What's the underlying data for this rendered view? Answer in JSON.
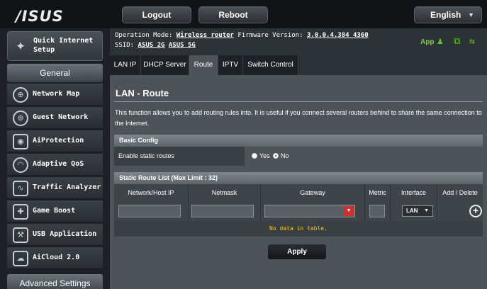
{
  "header": {
    "logo": "/ISUS",
    "logout_label": "Logout",
    "reboot_label": "Reboot",
    "language": "English"
  },
  "sidebar": {
    "quick_setup_label": "Quick Internet Setup",
    "general_label": "General",
    "items": [
      {
        "label": "Network Map",
        "icon": "network-map-icon"
      },
      {
        "label": "Guest Network",
        "icon": "guest-network-icon"
      },
      {
        "label": "AiProtection",
        "icon": "aiprotection-icon"
      },
      {
        "label": "Adaptive QoS",
        "icon": "adaptive-qos-icon"
      },
      {
        "label": "Traffic Analyzer",
        "icon": "traffic-analyzer-icon"
      },
      {
        "label": "Game Boost",
        "icon": "game-boost-icon"
      },
      {
        "label": "USB Application",
        "icon": "usb-application-icon"
      },
      {
        "label": "AiCloud 2.0",
        "icon": "aicloud-icon"
      }
    ],
    "advanced_label": "Advanced Settings"
  },
  "status": {
    "op_mode_label": "Operation Mode:",
    "op_mode_value": "Wireless router",
    "firmware_label": "Firmware Version:",
    "firmware_value": "3.0.0.4.384_4360",
    "ssid_label": "SSID:",
    "ssid_2g": "ASUS_2G",
    "ssid_5g": "ASUS_5G",
    "app_label": "App"
  },
  "tabs": [
    "LAN IP",
    "DHCP Server",
    "Route",
    "IPTV",
    "Switch Control"
  ],
  "active_tab": "Route",
  "page": {
    "title": "LAN - Route",
    "description": "This function allows you to add routing rules into. It is useful if you connect several routers behind to share the same connection to the Internet.",
    "basic_config_label": "Basic Config",
    "static_routes_label": "Enable static routes",
    "radio_yes": "Yes",
    "radio_no": "No",
    "static_routes_value": "No",
    "list_label": "Static Route List (Max Limit : 32)",
    "columns": [
      "Network/Host IP",
      "Netmask",
      "Gateway",
      "Metric",
      "Interface",
      "Add / Delete"
    ],
    "interface_value": "LAN",
    "empty_message": "No data in table.",
    "apply_label": "Apply"
  },
  "colors": {
    "accent_green": "#5ecb2b",
    "warning_yellow": "#ffcc00",
    "select_red": "#d22f2f"
  }
}
